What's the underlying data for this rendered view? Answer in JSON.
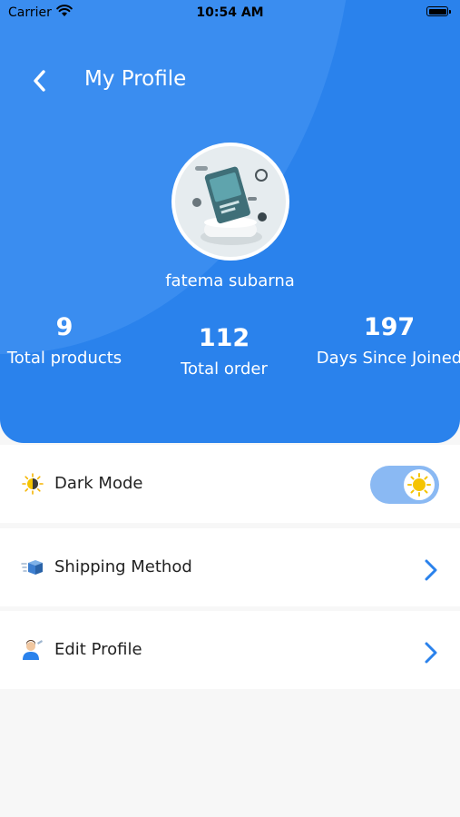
{
  "status_bar": {
    "carrier": "Carrier",
    "time": "10:54 AM"
  },
  "header": {
    "title": "My Profile"
  },
  "profile": {
    "name": "fatema subarna"
  },
  "stats": [
    {
      "value": "9",
      "label": "Total products"
    },
    {
      "value": "112",
      "label": "Total order"
    },
    {
      "value": "197",
      "label": "Days Since Joined"
    }
  ],
  "settings": {
    "dark_mode": {
      "label": "Dark Mode",
      "enabled": true
    },
    "shipping": {
      "label": "Shipping Method"
    },
    "edit_profile": {
      "label": "Edit Profile"
    }
  },
  "colors": {
    "primary": "#2a82ec",
    "toggle_track": "#8ab9f3",
    "chevron": "#2a82ec",
    "sun": "#f5c400"
  },
  "icons": {
    "back": "chevron-left-icon",
    "dark_mode": "sun-icon",
    "shipping": "box-icon",
    "edit_profile": "user-edit-icon",
    "row_arrow": "chevron-right-icon"
  }
}
